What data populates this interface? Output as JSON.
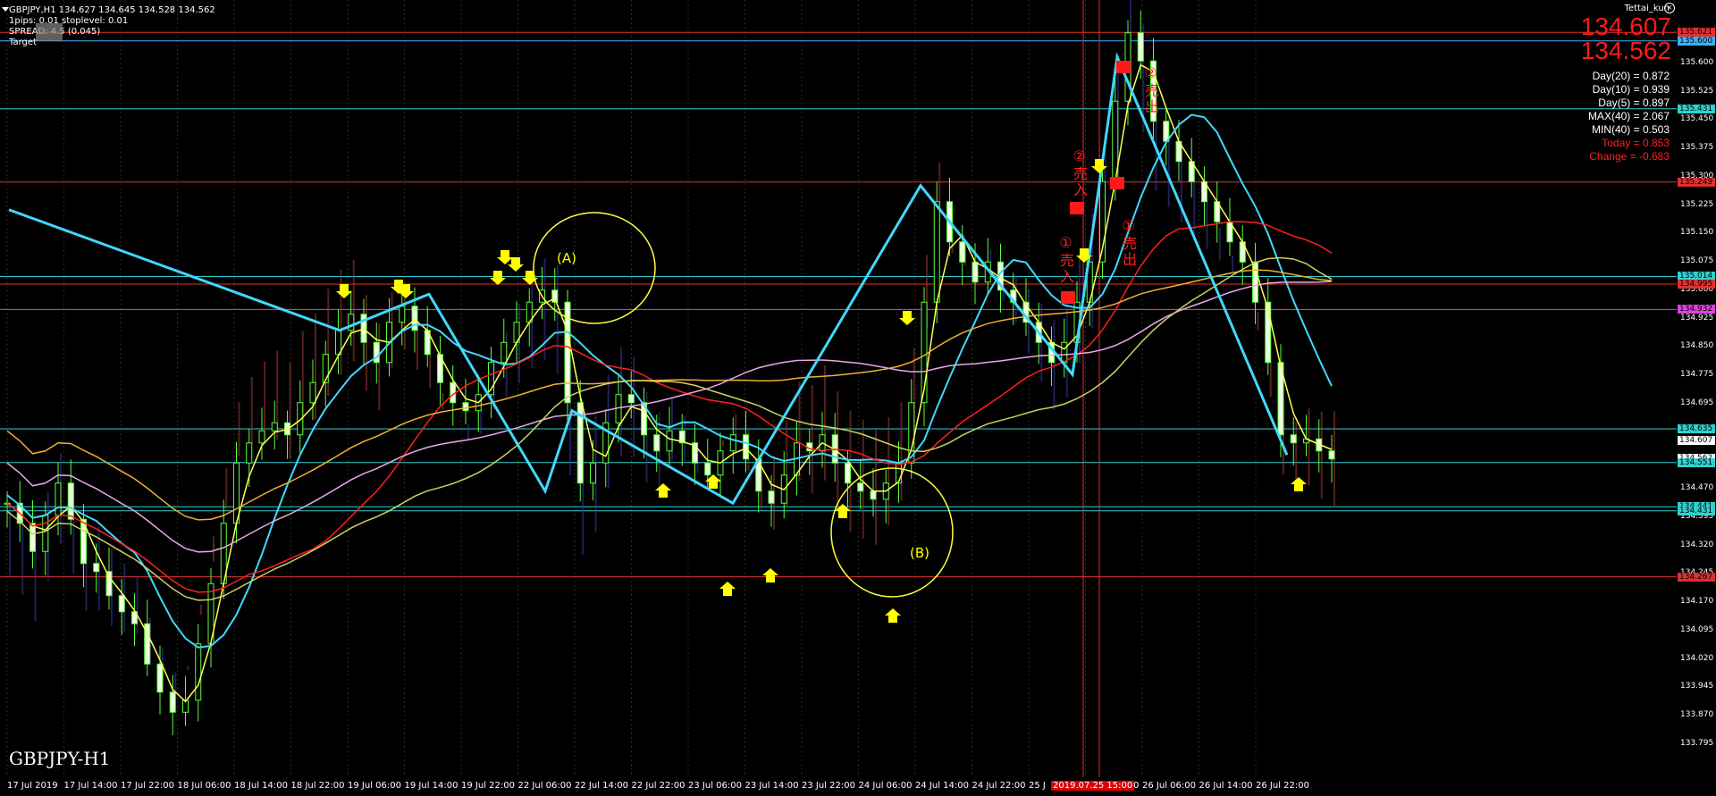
{
  "header": {
    "symbol_line": "GBPJPY,H1  134.627 134.645 134.528 134.562",
    "pips_line": "1pips: 0.01 stoplevel: 0.01",
    "spread_line": "SPREAD: 4.5 (0.045)",
    "target_line": "Target",
    "user": "Tettai_kun",
    "close_glyph": "×"
  },
  "prices": {
    "bid": "134.607",
    "ask": "134.562"
  },
  "stats": {
    "day20": "Day(20) = 0.872",
    "day10": "Day(10) = 0.939",
    "day5": "Day(5) = 0.897",
    "max40": "MAX(40) = 2.067",
    "min40": "MIN(40) = 0.503",
    "today": "Today = 0.853",
    "change": "Change = -0.683"
  },
  "symbol_label": "GBPJPY-H1",
  "annotations": {
    "sell_in_1": "①売入",
    "sell_in_2": "②売入",
    "sell_out_1": "①売出",
    "sell_out_2": "②売出",
    "circle_a": "(A)",
    "circle_b": "(B)"
  },
  "x_axis": {
    "labels": [
      "17 Jul 2019",
      "17 Jul 14:00",
      "17 Jul 22:00",
      "18 Jul 06:00",
      "18 Jul 14:00",
      "18 Jul 22:00",
      "19 Jul 06:00",
      "19 Jul 14:00",
      "19 Jul 22:00",
      "22 Jul 06:00",
      "22 Jul 14:00",
      "22 Jul 22:00",
      "23 Jul 06:00",
      "23 Jul 14:00",
      "23 Jul 22:00",
      "24 Jul 06:00",
      "24 Jul 14:00",
      "24 Jul 22:00",
      "25 J",
      "25 Jul 22:00",
      "26 Jul 06:00",
      "26 Jul 14:00",
      "26 Jul 22:00"
    ],
    "highlight": "2019.07.25 15:00"
  },
  "y_axis": {
    "ticks": [
      "135.675",
      "135.600",
      "135.525",
      "135.450",
      "135.375",
      "135.300",
      "135.225",
      "135.150",
      "135.075",
      "135.000",
      "134.925",
      "134.850",
      "134.775",
      "134.695",
      "134.620",
      "134.545",
      "134.470",
      "134.395",
      "134.320",
      "134.245",
      "134.170",
      "134.095",
      "134.020",
      "133.945",
      "133.870",
      "133.795"
    ],
    "tags": [
      {
        "text": "135.621",
        "color": "#e03030"
      },
      {
        "text": "135.600",
        "color": "#3ab0ff"
      },
      {
        "text": "135.431",
        "color": "#30d0d0"
      },
      {
        "text": "135.249",
        "color": "#e03030"
      },
      {
        "text": "135.014",
        "color": "#30d0d0"
      },
      {
        "text": "134.995",
        "color": "#e03030"
      },
      {
        "text": "134.932",
        "color": "#e040e0"
      },
      {
        "text": "134.635",
        "color": "#30d0d0"
      },
      {
        "text": "134.607",
        "color": "#ffffff"
      },
      {
        "text": "134.562",
        "color": "#ffffff"
      },
      {
        "text": "134.551",
        "color": "#30d0d0"
      },
      {
        "text": "134.441",
        "color": "#30d0d0"
      },
      {
        "text": "134.431",
        "color": "#30d0d0"
      },
      {
        "text": "134.267",
        "color": "#e03030"
      }
    ]
  },
  "chart_data": {
    "type": "candlestick",
    "ylim": [
      133.795,
      135.675
    ],
    "hlines": [
      {
        "price": 135.621,
        "color": "#e03030"
      },
      {
        "price": 135.6,
        "color": "#3ab0ff"
      },
      {
        "price": 135.431,
        "color": "#30d0d0"
      },
      {
        "price": 135.249,
        "color": "#e03030"
      },
      {
        "price": 135.014,
        "color": "#30d0d0"
      },
      {
        "price": 134.995,
        "color": "#e03030"
      },
      {
        "price": 134.932,
        "color": "#e040e0"
      },
      {
        "price": 134.635,
        "color": "#30d0d0"
      },
      {
        "price": 134.551,
        "color": "#30d0d0"
      },
      {
        "price": 134.441,
        "color": "#30d0d0"
      },
      {
        "price": 134.431,
        "color": "#30d0d0"
      },
      {
        "price": 134.267,
        "color": "#e03030"
      }
    ],
    "close_series": [
      134.45,
      134.4,
      134.33,
      134.42,
      134.5,
      134.41,
      134.3,
      134.28,
      134.22,
      134.18,
      134.15,
      134.05,
      133.98,
      133.93,
      133.96,
      134.1,
      134.25,
      134.4,
      134.55,
      134.6,
      134.63,
      134.65,
      134.62,
      134.7,
      134.75,
      134.82,
      134.88,
      134.92,
      134.85,
      134.8,
      134.9,
      134.94,
      134.88,
      134.82,
      134.75,
      134.7,
      134.68,
      134.72,
      134.8,
      134.85,
      134.9,
      134.95,
      134.98,
      134.95,
      134.7,
      134.5,
      134.55,
      134.65,
      134.72,
      134.7,
      134.62,
      134.58,
      134.63,
      134.6,
      134.55,
      134.52,
      134.58,
      134.62,
      134.56,
      134.48,
      134.45,
      134.52,
      134.6,
      134.58,
      134.62,
      134.55,
      134.5,
      134.48,
      134.46,
      134.5,
      134.55,
      134.7,
      134.95,
      135.2,
      135.1,
      135.05,
      135.0,
      135.05,
      134.98,
      134.95,
      134.9,
      134.85,
      134.8,
      134.85,
      134.95,
      135.05,
      135.25,
      135.45,
      135.62,
      135.55,
      135.4,
      135.35,
      135.3,
      135.25,
      135.2,
      135.15,
      135.1,
      135.05,
      134.95,
      134.8,
      134.62,
      134.6,
      134.61,
      134.58,
      134.56
    ],
    "series": [
      {
        "name": "",
        "color": "#ffff55"
      },
      {
        "name": "",
        "color": "#40d8ff"
      },
      {
        "name": "",
        "color": "#ff2020"
      },
      {
        "name": "",
        "color": "#f0b030"
      },
      {
        "name": "",
        "color": "#e8a8e8"
      },
      {
        "name": "",
        "color": "#cfd060"
      }
    ],
    "zigzag": [
      135.18,
      134.88,
      134.97,
      134.48,
      134.68,
      134.45,
      135.24,
      134.77,
      135.56,
      134.57
    ],
    "markers": {
      "sell_in": [
        {
          "index": 93,
          "price": 135.05
        },
        {
          "index": 96,
          "price": 135.23
        }
      ],
      "sell_out": [
        {
          "index": 100,
          "price": 135.28
        },
        {
          "index": 101,
          "price": 135.58
        }
      ]
    }
  }
}
